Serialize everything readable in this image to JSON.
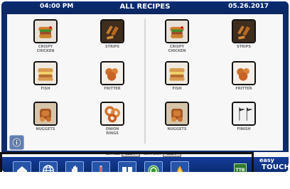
{
  "header": {
    "time": "04:00 PM",
    "title": "ALL RECIPES",
    "date": "05.26.2017"
  },
  "recipes": [
    {
      "label": "CRISPY\nCHICKEN",
      "icon": "crispy-chicken-icon"
    },
    {
      "label": "STRIPS",
      "icon": "strips-icon"
    },
    {
      "label": "CRISPY\nCHICKEN",
      "icon": "crispy-chicken-icon"
    },
    {
      "label": "STRIPS",
      "icon": "strips-icon"
    },
    {
      "label": "FISH",
      "icon": "fish-icon"
    },
    {
      "label": "FRITTER",
      "icon": "fritter-icon"
    },
    {
      "label": "FISH",
      "icon": "fish-icon"
    },
    {
      "label": "FRITTER",
      "icon": "fritter-icon"
    },
    {
      "label": "NUGGETS",
      "icon": "nuggets-icon"
    },
    {
      "label": "ONION\nRINGS",
      "icon": "onion-rings-icon"
    },
    {
      "label": "NUGGETS",
      "icon": "nuggets-icon"
    },
    {
      "label": "FINISH",
      "icon": "finish-icon"
    }
  ],
  "status": {
    "left_label": "ACTUAL",
    "left_value": "361 F",
    "right_label": "SETPOINT",
    "right_value": "361 F"
  },
  "toolbar": {
    "buttons": [
      {
        "icon": "home-icon"
      },
      {
        "icon": "globe-icon"
      },
      {
        "icon": "hand-icon"
      },
      {
        "icon": "thermometer-icon"
      },
      {
        "icon": "book-icon"
      },
      {
        "icon": "filter-icon"
      },
      {
        "icon": "oil-drop-icon"
      }
    ],
    "mini_button_text": "TTB"
  },
  "branding": {
    "easy": "easy",
    "touch": "TOUCH"
  }
}
